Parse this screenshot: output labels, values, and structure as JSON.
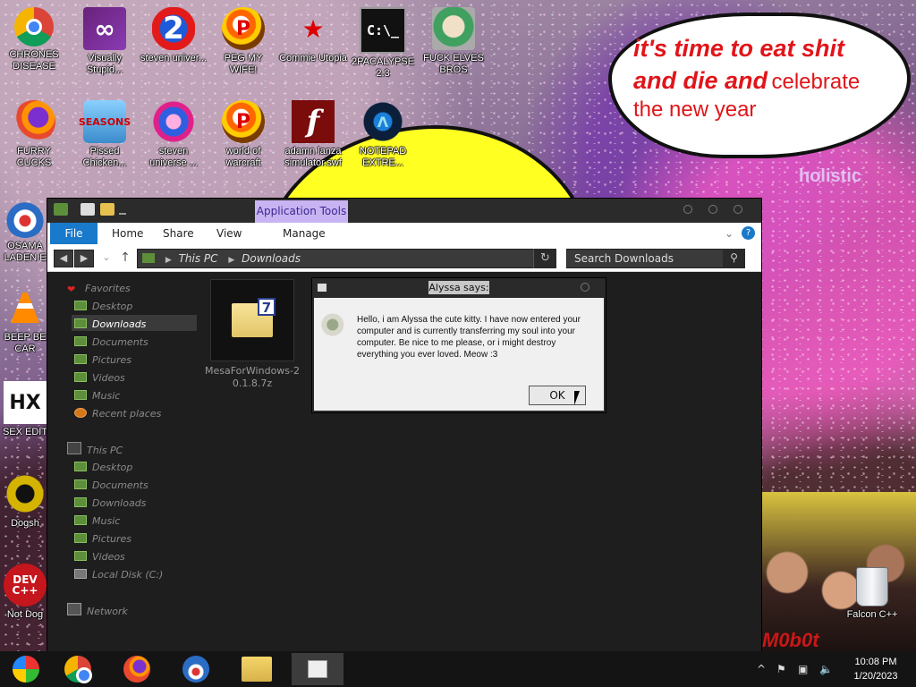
{
  "desktop": {
    "bubble": {
      "line1": "it's time to eat shit",
      "line2_bold": "and die and",
      "line2_thin": "celebrate",
      "line3": "the new year"
    },
    "wall_text": "holistic",
    "corner_text": "M0b0t",
    "icons": [
      {
        "label": "CHRONES DISEASE",
        "icon": "chrome-icon"
      },
      {
        "label": "Visually Stupid...",
        "icon": "visual-studio-icon"
      },
      {
        "label": "steven univer...",
        "icon": "steven-universe-2-icon"
      },
      {
        "label": "PEG MY WIFE!",
        "icon": "peggle-icon"
      },
      {
        "label": "Commie Utopia",
        "icon": "commie-icon"
      },
      {
        "label": "2PACALYPSE 2.3",
        "icon": "cmd-icon",
        "glyph": "C:\\_"
      },
      {
        "label": "FUCK ELVES BROS",
        "icon": "elves-icon"
      },
      {
        "label": "FURRY CUCKS",
        "icon": "firefox-icon"
      },
      {
        "label": "Pissed Chicken...",
        "icon": "angry-birds-icon",
        "glyph": "SEASONS"
      },
      {
        "label": "steven universe ...",
        "icon": "gem-icon"
      },
      {
        "label": "world of warcraft",
        "icon": "peggle-icon"
      },
      {
        "label": "adamn lanza simulator.swf",
        "icon": "flash-icon",
        "glyph": "f"
      },
      {
        "label": "NOTEPAD EXTRE...",
        "icon": "notepad-extreme-icon"
      },
      {
        "label": "OSAMA LADEN E",
        "icon": "obama-icon"
      },
      {
        "label": "BEEP BE CAR",
        "icon": "vlc-cone-icon"
      },
      {
        "label": "SEX EDIT",
        "icon": "hx-icon",
        "glyph": "HX"
      },
      {
        "label": "Dogsh",
        "icon": "dogs-icon"
      },
      {
        "label": "Not Dog",
        "icon": "devcpp-icon",
        "glyph": "DEV C++"
      },
      {
        "label": "Falcon C++",
        "icon": "recycle-bin-icon"
      }
    ]
  },
  "explorer": {
    "ribbon_context_tab": "Application Tools",
    "tabs": [
      "File",
      "Home",
      "Share",
      "View",
      "Manage"
    ],
    "breadcrumb": [
      "This PC",
      "Downloads"
    ],
    "search_placeholder": "Search Downloads",
    "favorites_header": "Favorites",
    "favorites": [
      "Desktop",
      "Downloads",
      "Documents",
      "Pictures",
      "Videos",
      "Music",
      "Recent places"
    ],
    "thispc_header": "This PC",
    "thispc": [
      "Desktop",
      "Documents",
      "Downloads",
      "Music",
      "Pictures",
      "Videos",
      "Local Disk (C:)"
    ],
    "network": "Network",
    "selected_nav": "Downloads",
    "file": {
      "name": "MesaForWindows-20.1.8.7z",
      "badge": "7"
    }
  },
  "dialog": {
    "title": "Alyssa says:",
    "message": "Hello, i am Alyssa the cute kitty. I have now entered your computer and is currently transferring my soul into your computer. Be nice to me please, or i might destroy everything you ever loved. Meow :3",
    "ok_label": "OK"
  },
  "taskbar": {
    "items": [
      "start-button",
      "chrome-taskbar",
      "firefox-taskbar",
      "obama-taskbar",
      "file-explorer-taskbar",
      "active-window-taskbar"
    ],
    "time": "10:08 PM",
    "date": "1/20/2023",
    "tray_chevron": "^"
  },
  "colors": {
    "ribbon_file": "#1979ca",
    "context_tab": "#c9b4f3",
    "bubble_text": "#e0151a",
    "taskbar": "#141414"
  }
}
